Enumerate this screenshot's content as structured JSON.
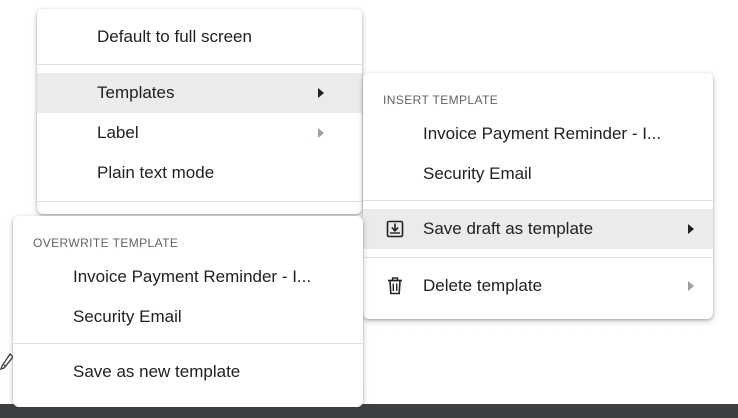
{
  "main_menu": {
    "items": [
      {
        "label": "Default to full screen"
      },
      {
        "label": "Templates"
      },
      {
        "label": "Label"
      },
      {
        "label": "Plain text mode"
      }
    ]
  },
  "templates_menu": {
    "section_title": "INSERT TEMPLATE",
    "insert_items": [
      {
        "label": "Invoice Payment Reminder - I..."
      },
      {
        "label": "Security Email"
      }
    ],
    "save_label": "Save draft as template",
    "delete_label": "Delete template",
    "save_icon": "save-template-icon",
    "delete_icon": "trash-icon"
  },
  "overwrite_menu": {
    "section_title": "OVERWRITE TEMPLATE",
    "items": [
      {
        "label": "Invoice Payment Reminder - I..."
      },
      {
        "label": "Security Email"
      }
    ],
    "new_label": "Save as new template"
  },
  "colors": {
    "hover": "#ebebeb",
    "text": "#202124",
    "muted": "#5f6368",
    "divider": "#e0e0e0"
  }
}
